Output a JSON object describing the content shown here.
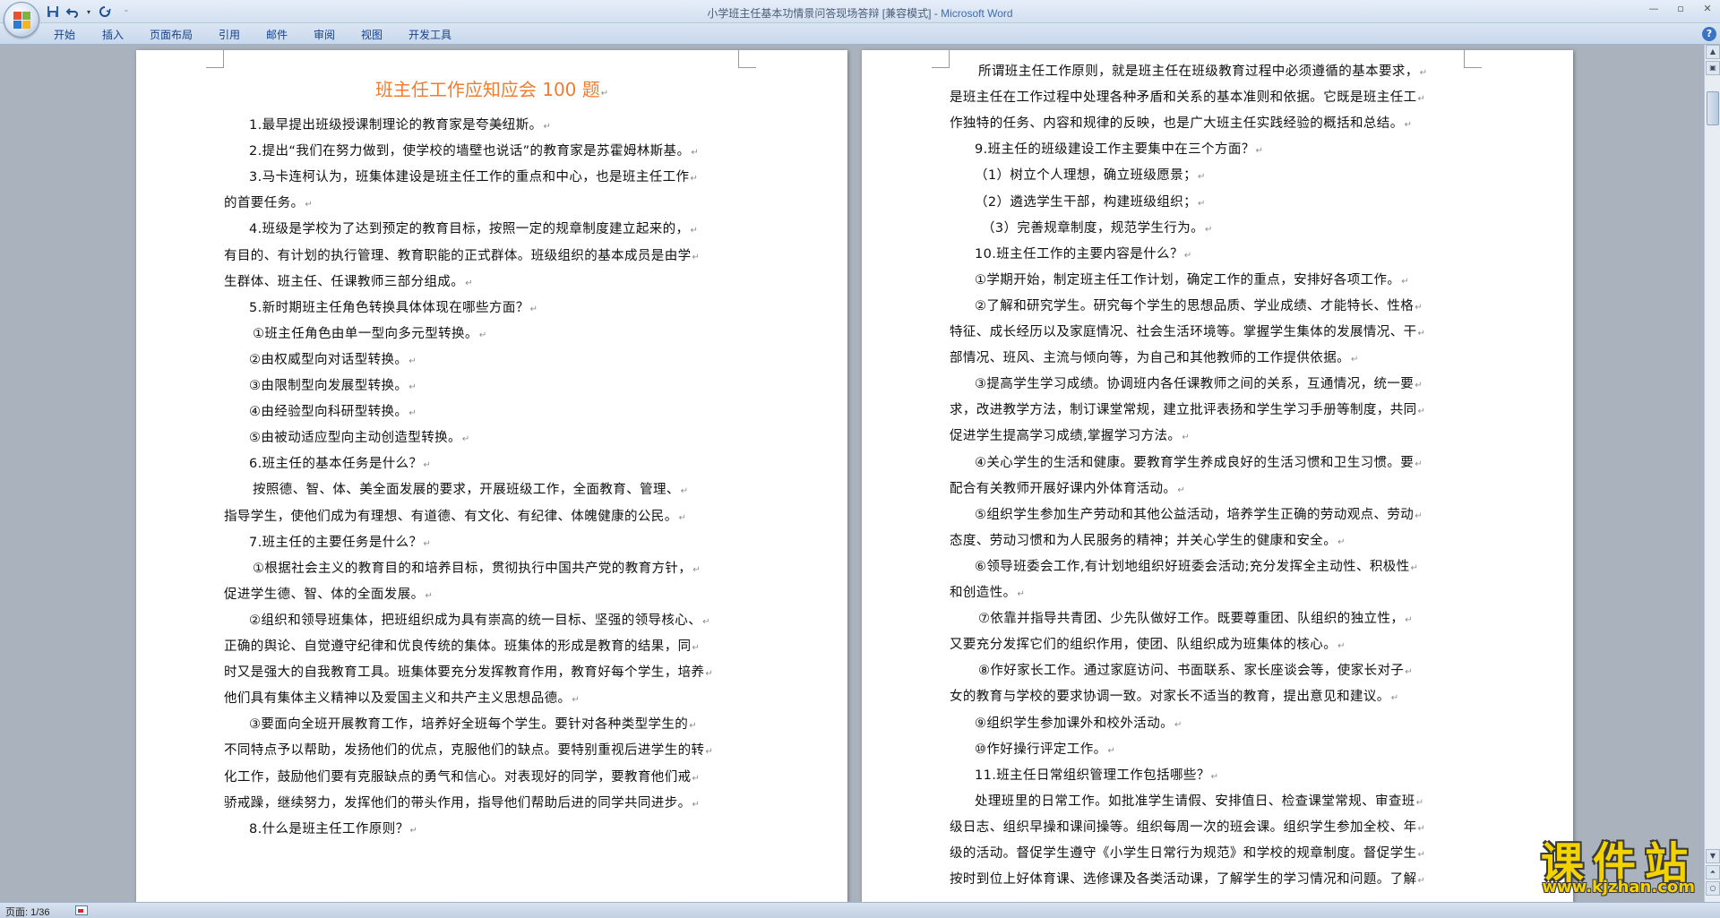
{
  "window": {
    "title_doc": "小学班主任基本功情景问答现场答辩 [兼容模式]",
    "title_sep": " - ",
    "title_app": "Microsoft Word"
  },
  "ribbon": {
    "tabs": [
      "开始",
      "插入",
      "页面布局",
      "引用",
      "邮件",
      "审阅",
      "视图",
      "开发工具"
    ]
  },
  "status": {
    "page": "页面: 1/36"
  },
  "document": {
    "title": "班主任工作应知应会 100 题",
    "page1_lines": [
      "1.最早提出班级授课制理论的教育家是夸美纽斯。",
      "2.提出“我们在努力做到，使学校的墙壁也说话”的教育家是苏霍姆林斯基。",
      "3.马卡连柯认为，班集体建设是班主任工作的重点和中心，也是班主任工作",
      "的首要任务。",
      "4.班级是学校为了达到预定的教育目标，按照一定的规章制度建立起来的，",
      "有目的、有计划的执行管理、教育职能的正式群体。班级组织的基本成员是由学",
      "生群体、班主任、任课教师三部分组成。",
      "5.新时期班主任角色转换具体体现在哪些方面？",
      "①班主任角色由单一型向多元型转换。",
      "②由权威型向对话型转换。",
      "③由限制型向发展型转换。",
      "④由经验型向科研型转换。",
      "⑤由被动适应型向主动创造型转换。",
      "6.班主任的基本任务是什么？",
      "按照德、智、体、美全面发展的要求，开展班级工作，全面教育、管理、",
      "指导学生，使他们成为有理想、有道德、有文化、有纪律、体魄健康的公民。",
      "7.班主任的主要任务是什么？",
      "①根据社会主义的教育目的和培养目标，贯彻执行中国共产党的教育方针，",
      "促进学生德、智、体的全面发展。",
      "②组织和领导班集体，把班组织成为具有崇高的统一目标、坚强的领导核心、",
      "正确的舆论、自觉遵守纪律和优良传统的集体。班集体的形成是教育的结果，同",
      "时又是强大的自我教育工具。班集体要充分发挥教育作用，教育好每个学生，培养",
      "他们具有集体主义精神以及爱国主义和共产主义思想品德。",
      "③要面向全班开展教育工作，培养好全班每个学生。要针对各种类型学生的",
      "不同特点予以帮助，发扬他们的优点，克服他们的缺点。要特别重视后进学生的转",
      "化工作，鼓励他们要有克服缺点的勇气和信心。对表现好的同学，要教育他们戒",
      "骄戒躁，继续努力，发挥他们的带头作用，指导他们帮助后进的同学共同进步。",
      "8.什么是班主任工作原则？"
    ],
    "page2_lines": [
      "所谓班主任工作原则，就是班主任在班级教育过程中必须遵循的基本要求，",
      "是班主任在工作过程中处理各种矛盾和关系的基本准则和依据。它既是班主任工",
      "作独特的任务、内容和规律的反映，也是广大班主任实践经验的概括和总结。",
      "9.班主任的班级建设工作主要集中在三个方面？",
      "（1）树立个人理想，确立班级愿景；",
      "（2）遴选学生干部，构建班级组织；",
      "（3）完善规章制度，规范学生行为。",
      "10.班主任工作的主要内容是什么？",
      "①学期开始，制定班主任工作计划，确定工作的重点，安排好各项工作。",
      "②了解和研究学生。研究每个学生的思想品质、学业成绩、才能特长、性格",
      "特征、成长经历以及家庭情况、社会生活环境等。掌握学生集体的发展情况、干",
      "部情况、班风、主流与倾向等，为自己和其他教师的工作提供依据。",
      "③提高学生学习成绩。协调班内各任课教师之间的关系，互通情况，统一要",
      "求，改进教学方法，制订课堂常规，建立批评表扬和学生学习手册等制度，共同",
      "促进学生提高学习成绩,掌握学习方法。",
      "④关心学生的生活和健康。要教育学生养成良好的生活习惯和卫生习惯。要",
      "配合有关教师开展好课内外体育活动。",
      "⑤组织学生参加生产劳动和其他公益活动，培养学生正确的劳动观点、劳动",
      "态度、劳动习惯和为人民服务的精神；并关心学生的健康和安全。",
      "⑥领导班委会工作,有计划地组织好班委会活动;充分发挥全主动性、积极性",
      "和创造性。",
      "⑦依靠并指导共青团、少先队做好工作。既要尊重团、队组织的独立性，",
      "又要充分发挥它们的组织作用，使团、队组织成为班集体的核心。",
      "⑧作好家长工作。通过家庭访问、书面联系、家长座谈会等，使家长对子",
      "女的教育与学校的要求协调一致。对家长不适当的教育，提出意见和建议。",
      "⑨组织学生参加课外和校外活动。",
      "⑩作好操行评定工作。",
      "11.班主任日常组织管理工作包括哪些？",
      "处理班里的日常工作。如批准学生请假、安排值日、检查课堂常规、审查班",
      "级日志、组织早操和课间操等。组织每周一次的班会课。组织学生参加全校、年",
      "级的活动。督促学生遵守《小学生日常行为规范》和学校的规章制度。督促学生",
      "按时到位上好体育课、选修课及各类活动课，了解学生的学习情况和问题。了解"
    ]
  },
  "watermark": {
    "title": "课件站",
    "url": "www.kjzhan.com"
  }
}
